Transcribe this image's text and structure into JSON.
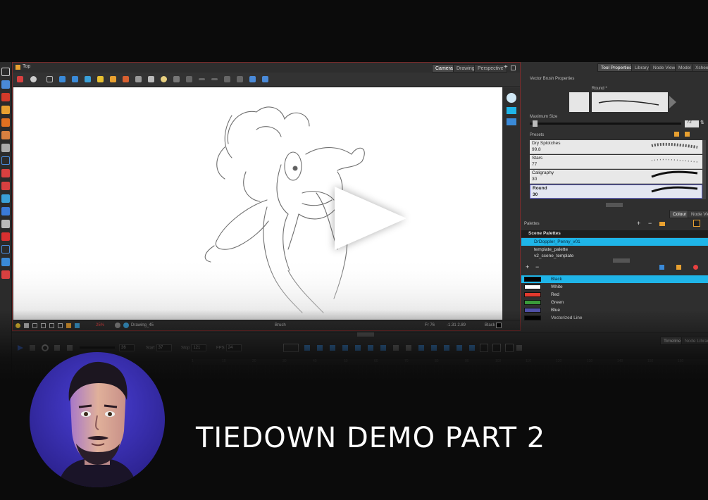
{
  "app": {
    "panel_label": "Top",
    "view_tabs": [
      "Camera",
      "Drawing",
      "Perspective"
    ],
    "status": {
      "zoom": "25%",
      "layer": "Drawing_45",
      "tool": "Brush",
      "frame": "Fr 76",
      "coords": "-1.31 2.89",
      "color": "Black"
    }
  },
  "tool_properties": {
    "tabs": [
      "Tool Properties",
      "Library",
      "Node View",
      "Model",
      "Xsheet"
    ],
    "section": "Vector Brush Properties",
    "brush_label": "Round *",
    "max_size_label": "Maximum Size",
    "max_size_value": "72",
    "presets_label": "Presets",
    "presets": [
      {
        "name": "Dry Splotches",
        "value": "99.8"
      },
      {
        "name": "Stars",
        "value": "77"
      },
      {
        "name": "Caligraphy",
        "value": "30"
      },
      {
        "name": "Round",
        "value": "30"
      }
    ]
  },
  "palettes": {
    "tabs": [
      "Colour",
      "Node View"
    ],
    "header": "Palettes",
    "scene_label": "Scene Palettes",
    "list": [
      "DrDoppler_Penny_v01",
      "template_palette",
      "v2_scene_template"
    ],
    "colors": [
      {
        "name": "Black",
        "hex": "#000000"
      },
      {
        "name": "White",
        "hex": "#ffffff"
      },
      {
        "name": "Red",
        "hex": "#e23a2e"
      },
      {
        "name": "Green",
        "hex": "#3a9a3a"
      },
      {
        "name": "Blue",
        "hex": "#5050a8"
      },
      {
        "name": "Vectorized Line",
        "hex": "#000000"
      }
    ]
  },
  "timeline": {
    "tabs": [
      "Timeline",
      "Node Library"
    ],
    "fields": [
      {
        "label": "",
        "value": "36"
      },
      {
        "label": "Start",
        "value": "37"
      },
      {
        "label": "Stop",
        "value": "121"
      },
      {
        "label": "FPS",
        "value": "24"
      }
    ],
    "ruler": [
      "1",
      "10",
      "20",
      "30",
      "40",
      "50",
      "60",
      "70",
      "80",
      "90",
      "100",
      "110",
      "120",
      "130",
      "140",
      "150",
      "160"
    ]
  },
  "video": {
    "title": "TIEDOWN DEMO PART 2"
  },
  "colors": {
    "accent": "#1fb5e8",
    "border_red": "#7a2a2a"
  }
}
